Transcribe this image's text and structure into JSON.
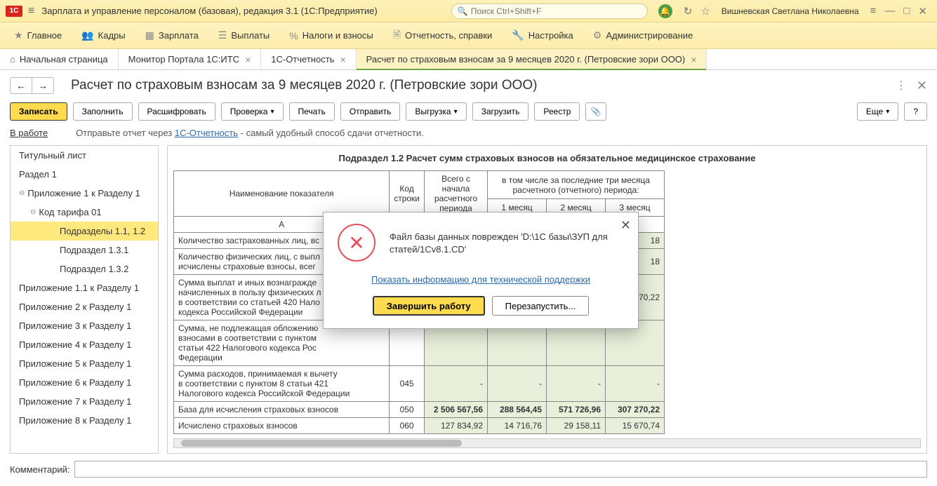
{
  "titlebar": {
    "logo": "1C",
    "title": "Зарплата и управление персоналом (базовая), редакция 3.1  (1С:Предприятие)",
    "search_placeholder": "Поиск Ctrl+Shift+F",
    "user": "Вишневская Светлана Николаевна"
  },
  "menubar": [
    {
      "icon": "★",
      "label": "Главное"
    },
    {
      "icon": "👥",
      "label": "Кадры"
    },
    {
      "icon": "▦",
      "label": "Зарплата"
    },
    {
      "icon": "☰",
      "label": "Выплаты"
    },
    {
      "icon": "%",
      "label": "Налоги и взносы"
    },
    {
      "icon": "🗎",
      "label": "Отчетность, справки"
    },
    {
      "icon": "🔧",
      "label": "Настройка"
    },
    {
      "icon": "⚙",
      "label": "Администрирование"
    }
  ],
  "tabs": [
    {
      "label": "Начальная страница",
      "closable": false,
      "home": true
    },
    {
      "label": "Монитор Портала 1С:ИТС",
      "closable": true
    },
    {
      "label": "1С-Отчетность",
      "closable": true
    },
    {
      "label": "Расчет по страховым взносам за 9 месяцев 2020 г. (Петровские зори ООО)",
      "closable": true,
      "active": true
    }
  ],
  "page_title": "Расчет по страховым взносам за 9 месяцев 2020 г. (Петровские зори ООО)",
  "toolbar": {
    "write": "Записать",
    "fill": "Заполнить",
    "decode": "Расшифровать",
    "check": "Проверка",
    "print": "Печать",
    "send": "Отправить",
    "export": "Выгрузка",
    "import": "Загрузить",
    "registry": "Реестр",
    "more": "Еще",
    "help": "?"
  },
  "status": {
    "label": "В работе",
    "prefix": "Отправьте отчет через ",
    "link": "1С-Отчетность",
    "suffix": " - самый удобный способ сдачи отчетности."
  },
  "tree": [
    {
      "label": "Титульный лист",
      "lvl": 1
    },
    {
      "label": "Раздел 1",
      "lvl": 1
    },
    {
      "label": "Приложение 1 к Разделу 1",
      "lvl": 1,
      "exp": "⊖"
    },
    {
      "label": "Код тарифа 01",
      "lvl": 2,
      "exp": "⊖"
    },
    {
      "label": "Подразделы 1.1, 1.2",
      "lvl": 4,
      "sel": true
    },
    {
      "label": "Подраздел 1.3.1",
      "lvl": 4
    },
    {
      "label": "Подраздел 1.3.2",
      "lvl": 4
    },
    {
      "label": "Приложение 1.1 к Разделу 1",
      "lvl": 1
    },
    {
      "label": "Приложение 2 к Разделу 1",
      "lvl": 1
    },
    {
      "label": "Приложение 3 к Разделу 1",
      "lvl": 1
    },
    {
      "label": "Приложение 4 к Разделу 1",
      "lvl": 1
    },
    {
      "label": "Приложение 5 к Разделу 1",
      "lvl": 1
    },
    {
      "label": "Приложение 6 к Разделу 1",
      "lvl": 1
    },
    {
      "label": "Приложение 7 к Разделу 1",
      "lvl": 1
    },
    {
      "label": "Приложение 8 к Разделу 1",
      "lvl": 1
    }
  ],
  "table": {
    "title": "Подраздел 1.2 Расчет сумм страховых взносов на обязательное медицинское страхование",
    "h_name": "Наименование показателя",
    "h_code": "Код строки",
    "h_total": "Всего с начала расчетного периода",
    "h_last3": "в том числе за последние три месяца расчетного (отчетного) периода:",
    "h_m1": "1 месяц",
    "h_m2": "2 месяц",
    "h_m3": "3 месяц",
    "h_a": "А",
    "rows": [
      {
        "name": "Количество застрахованных лиц, вс",
        "code": "",
        "v3": "18"
      },
      {
        "name": "Количество физических лиц, с выпл\nисчислены страховые взносы, всег",
        "code": "",
        "v3": "18"
      },
      {
        "name": "Сумма выплат и иных вознагражде\nначисленных в пользу физических л\nв соответствии со статьей 420 Нало\nкодекса Российской Федерации",
        "code": "",
        "v3": "270,22"
      },
      {
        "name": "Сумма, не подлежащая обложению\nвзносами в соответствии с пунктом\nстатьи 422 Налогового кодекса Рос\nФедерации",
        "code": "",
        "v3": ""
      },
      {
        "name": "Сумма расходов, принимаемая к вычету\nв соответствии с пунктом 8 статьи 421\nНалогового кодекса Российской Федерации",
        "code": "045",
        "total": "-",
        "v1": "-",
        "v2": "-",
        "v3": "-"
      },
      {
        "name": "База для исчисления страховых взносов",
        "code": "050",
        "total": "2 506 567,56",
        "v1": "288 564,45",
        "v2": "571 726,96",
        "v3": "307 270,22",
        "bold": true
      },
      {
        "name": "Исчислено страховых взносов",
        "code": "060",
        "total": "127 834,92",
        "v1": "14 716,76",
        "v2": "29 158,11",
        "v3": "15 670,74"
      }
    ]
  },
  "comment_label": "Комментарий:",
  "dialog": {
    "message": "Файл базы данных поврежден 'D:\\1С базы\\ЗУП для статей/1Cv8.1.CD'",
    "link": "Показать информацию для технической поддержки",
    "btn1": "Завершить работу",
    "btn2": "Перезапустить..."
  }
}
